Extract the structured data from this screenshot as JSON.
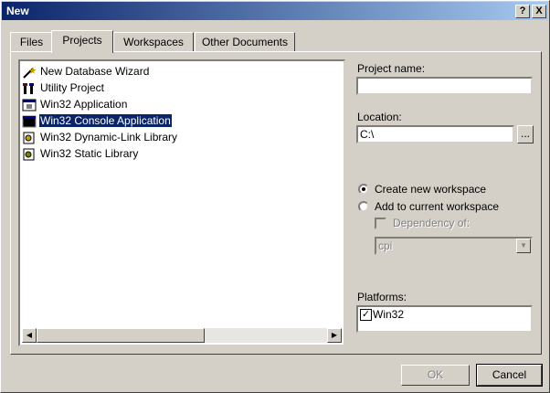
{
  "window": {
    "title": "New",
    "help": "?",
    "close": "X"
  },
  "tabs": [
    {
      "label": "Files"
    },
    {
      "label": "Projects"
    },
    {
      "label": "Workspaces"
    },
    {
      "label": "Other Documents"
    }
  ],
  "projects": [
    {
      "label": "New Database Wizard",
      "icon": "wizard-icon"
    },
    {
      "label": "Utility Project",
      "icon": "utility-icon"
    },
    {
      "label": "Win32 Application",
      "icon": "app-icon"
    },
    {
      "label": "Win32 Console Application",
      "icon": "console-icon",
      "selected": true
    },
    {
      "label": "Win32 Dynamic-Link Library",
      "icon": "dll-icon"
    },
    {
      "label": "Win32 Static Library",
      "icon": "lib-icon"
    }
  ],
  "form": {
    "project_name_label": "Project name:",
    "project_name_value": "",
    "location_label": "Location:",
    "location_value": "C:\\",
    "browse_label": "...",
    "create_new_label": "Create new workspace",
    "add_current_label": "Add to current workspace",
    "dependency_label": "Dependency of:",
    "dependency_value": "cpi",
    "platforms_label": "Platforms:",
    "platform_item": "Win32"
  },
  "buttons": {
    "ok": "OK",
    "cancel": "Cancel"
  }
}
